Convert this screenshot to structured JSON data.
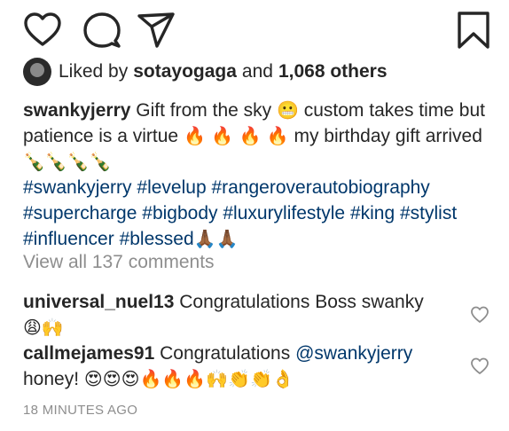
{
  "actions": {
    "like_icon": "heart-outline",
    "comment_icon": "speech-bubble",
    "share_icon": "paper-plane",
    "save_icon": "bookmark"
  },
  "likes": {
    "prefix": "Liked by",
    "user": "sotayogaga",
    "conjunction": "and",
    "others": "1,068 others"
  },
  "caption": {
    "username": "swankyjerry",
    "text_1": "Gift from the sky",
    "emoji_1": "😬",
    "text_2": "custom takes time but patience is a virtue",
    "emoji_2": "🔥 🔥 🔥 🔥",
    "text_3": "my birthday gift arrived",
    "emoji_3": "🍾🍾🍾🍾",
    "hashtags": [
      "#swankyjerry",
      "#levelup",
      "#rangeroverautobiography",
      "#supercharge",
      "#bigbody",
      "#luxurylifestyle",
      "#king",
      "#stylist",
      "#influencer",
      "#blessed"
    ],
    "emoji_4": "🙏🏾🙏🏾"
  },
  "view_all_comments": "View all 137 comments",
  "comments": [
    {
      "username": "universal_nuel13",
      "text": "Congratulations Boss swanky",
      "emoji": "😩🙌"
    },
    {
      "username": "callmejames91",
      "text": "Congratulations",
      "mention": "@swankyjerry",
      "text_2": "honey!",
      "emoji": "😍😍😍🔥🔥🔥🙌👏👏👌"
    }
  ],
  "timestamp": "18 MINUTES AGO",
  "colors": {
    "text": "#262626",
    "link": "#00376b",
    "muted": "#8e8e8e"
  }
}
